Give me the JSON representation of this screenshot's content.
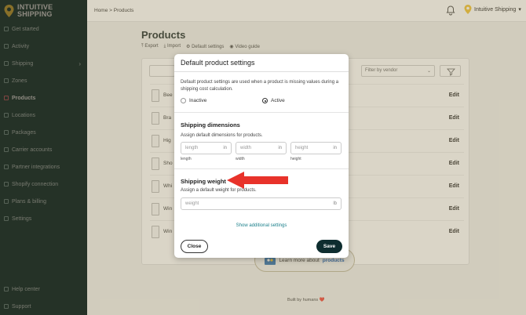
{
  "app": {
    "logo_line1": "INTUITIVE",
    "logo_line2": "SHIPPING"
  },
  "sidebar": {
    "items": [
      {
        "label": "Get started"
      },
      {
        "label": "Activity"
      },
      {
        "label": "Shipping"
      },
      {
        "label": "Zones"
      },
      {
        "label": "Products"
      },
      {
        "label": "Locations"
      },
      {
        "label": "Packages"
      },
      {
        "label": "Carrier accounts"
      },
      {
        "label": "Partner integrations"
      },
      {
        "label": "Shopify connection"
      },
      {
        "label": "Plans & billing"
      },
      {
        "label": "Settings"
      }
    ],
    "help": "Help center",
    "support": "Support"
  },
  "topbar": {
    "breadcrumb": "Home > Products",
    "account": "Intuitive Shipping"
  },
  "page": {
    "title": "Products",
    "export": "Export",
    "import": "Import",
    "default_settings": "Default settings",
    "video_guide": "Video guide",
    "vendor_placeholder": "Filter by vendor"
  },
  "products": [
    {
      "name": "Bee",
      "edit": "Edit"
    },
    {
      "name": "Bra",
      "edit": "Edit"
    },
    {
      "name": "Hig",
      "edit": "Edit"
    },
    {
      "name": "Sho",
      "edit": "Edit"
    },
    {
      "name": "Whi",
      "edit": "Edit"
    },
    {
      "name": "Win",
      "edit": "Edit"
    },
    {
      "name": "Win",
      "edit": "Edit"
    }
  ],
  "learn": {
    "prefix": "Learn more about",
    "link": "products"
  },
  "footer": "Built by humans ❤️",
  "modal": {
    "title": "Default product settings",
    "description": "Default product settings are used when a product is missing values during a shipping cost calculation.",
    "inactive": "Inactive",
    "active": "Active",
    "selected": "Active",
    "dimensions": {
      "title": "Shipping dimensions",
      "desc": "Assign default dimensions for products.",
      "length": {
        "placeholder": "length",
        "unit": "in",
        "label": "length"
      },
      "width": {
        "placeholder": "width",
        "unit": "in",
        "label": "width"
      },
      "height": {
        "placeholder": "height",
        "unit": "in",
        "label": "height"
      }
    },
    "weight": {
      "title": "Shipping weight",
      "desc": "Assign a default weight for products.",
      "placeholder": "weight",
      "unit": "lb"
    },
    "more": "Show additional settings",
    "close": "Close",
    "save": "Save"
  },
  "colors": {
    "sidebar_bg": "#0a2e2b",
    "save_bg": "#0e2d2f",
    "arrow": "#e8322a",
    "link": "#1a7f8a"
  }
}
